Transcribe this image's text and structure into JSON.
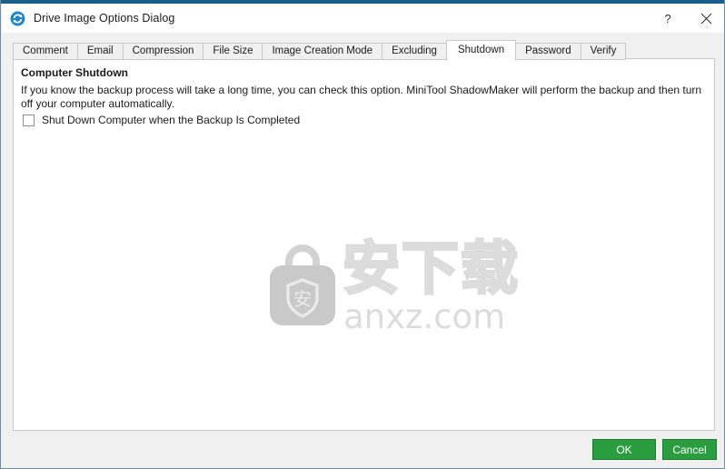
{
  "window": {
    "title": "Drive Image Options Dialog",
    "icon": "refresh-circular-arrows-icon",
    "help_label": "?",
    "close_label": "✕"
  },
  "tabs": [
    {
      "label": "Comment",
      "active": false
    },
    {
      "label": "Email",
      "active": false
    },
    {
      "label": "Compression",
      "active": false
    },
    {
      "label": "File Size",
      "active": false
    },
    {
      "label": "Image Creation Mode",
      "active": false
    },
    {
      "label": "Excluding",
      "active": false
    },
    {
      "label": "Shutdown",
      "active": true
    },
    {
      "label": "Password",
      "active": false
    },
    {
      "label": "Verify",
      "active": false
    }
  ],
  "panel": {
    "heading": "Computer Shutdown",
    "description": "If you know the backup process will take a long time, you can check this option. MiniTool ShadowMaker will perform the backup and then turn off your computer automatically.",
    "checkbox": {
      "label": "Shut Down Computer when the Backup Is Completed",
      "checked": false
    }
  },
  "watermark": {
    "cn_text": "安下载",
    "url_text": "anxz.com",
    "bag_glyph": "安",
    "color": "#dcdcdc"
  },
  "footer": {
    "ok_label": "OK",
    "cancel_label": "Cancel",
    "button_color": "#2a9d3f",
    "button_border_color": "#1d7a32"
  },
  "theme": {
    "accent": "#1a5e8a",
    "window_bg": "#f0f0f0",
    "panel_bg": "#ffffff",
    "border": "#c8c8c8",
    "text": "#1b1b1b"
  }
}
